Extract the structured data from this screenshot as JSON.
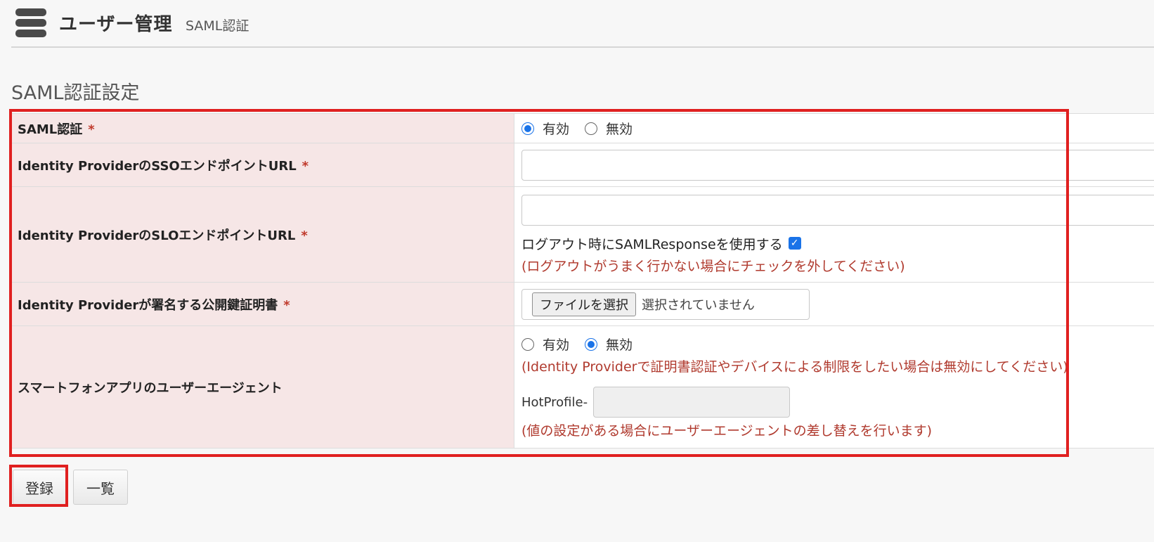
{
  "header": {
    "icon": "database-stack-icon",
    "title": "ユーザー管理",
    "subtitle": "SAML認証"
  },
  "section_title": "SAML認証設定",
  "required_mark": "*",
  "form": {
    "saml_auth": {
      "label": "SAML認証",
      "options": [
        "有効",
        "無効"
      ],
      "selected": "有効"
    },
    "sso_url": {
      "label": "Identity ProviderのSSOエンドポイントURL",
      "value": ""
    },
    "slo_url": {
      "label": "Identity ProviderのSLOエンドポイントURL",
      "value": "",
      "checkbox_label": "ログアウト時にSAMLResponseを使用する",
      "checkbox_checked": true,
      "note": "(ログアウトがうまく行かない場合にチェックを外してください)"
    },
    "certificate": {
      "label": "Identity Providerが署名する公開鍵証明書",
      "file_button": "ファイルを選択",
      "file_status": "選択されていません"
    },
    "user_agent": {
      "label": "スマートフォンアプリのユーザーエージェント",
      "options": [
        "有効",
        "無効"
      ],
      "selected": "無効",
      "note1": "(Identity Providerで証明書認証やデバイスによる制限をしたい場合は無効にしてください)",
      "prefix": "HotProfile-",
      "value": "",
      "note2": "(値の設定がある場合にユーザーエージェントの差し替えを行います)"
    }
  },
  "buttons": {
    "submit": "登録",
    "list": "一覧"
  },
  "colors": {
    "highlight": "#e02020",
    "label_bg": "#f6e6e6",
    "note": "#b03a2e",
    "accent": "#1a73e8"
  }
}
